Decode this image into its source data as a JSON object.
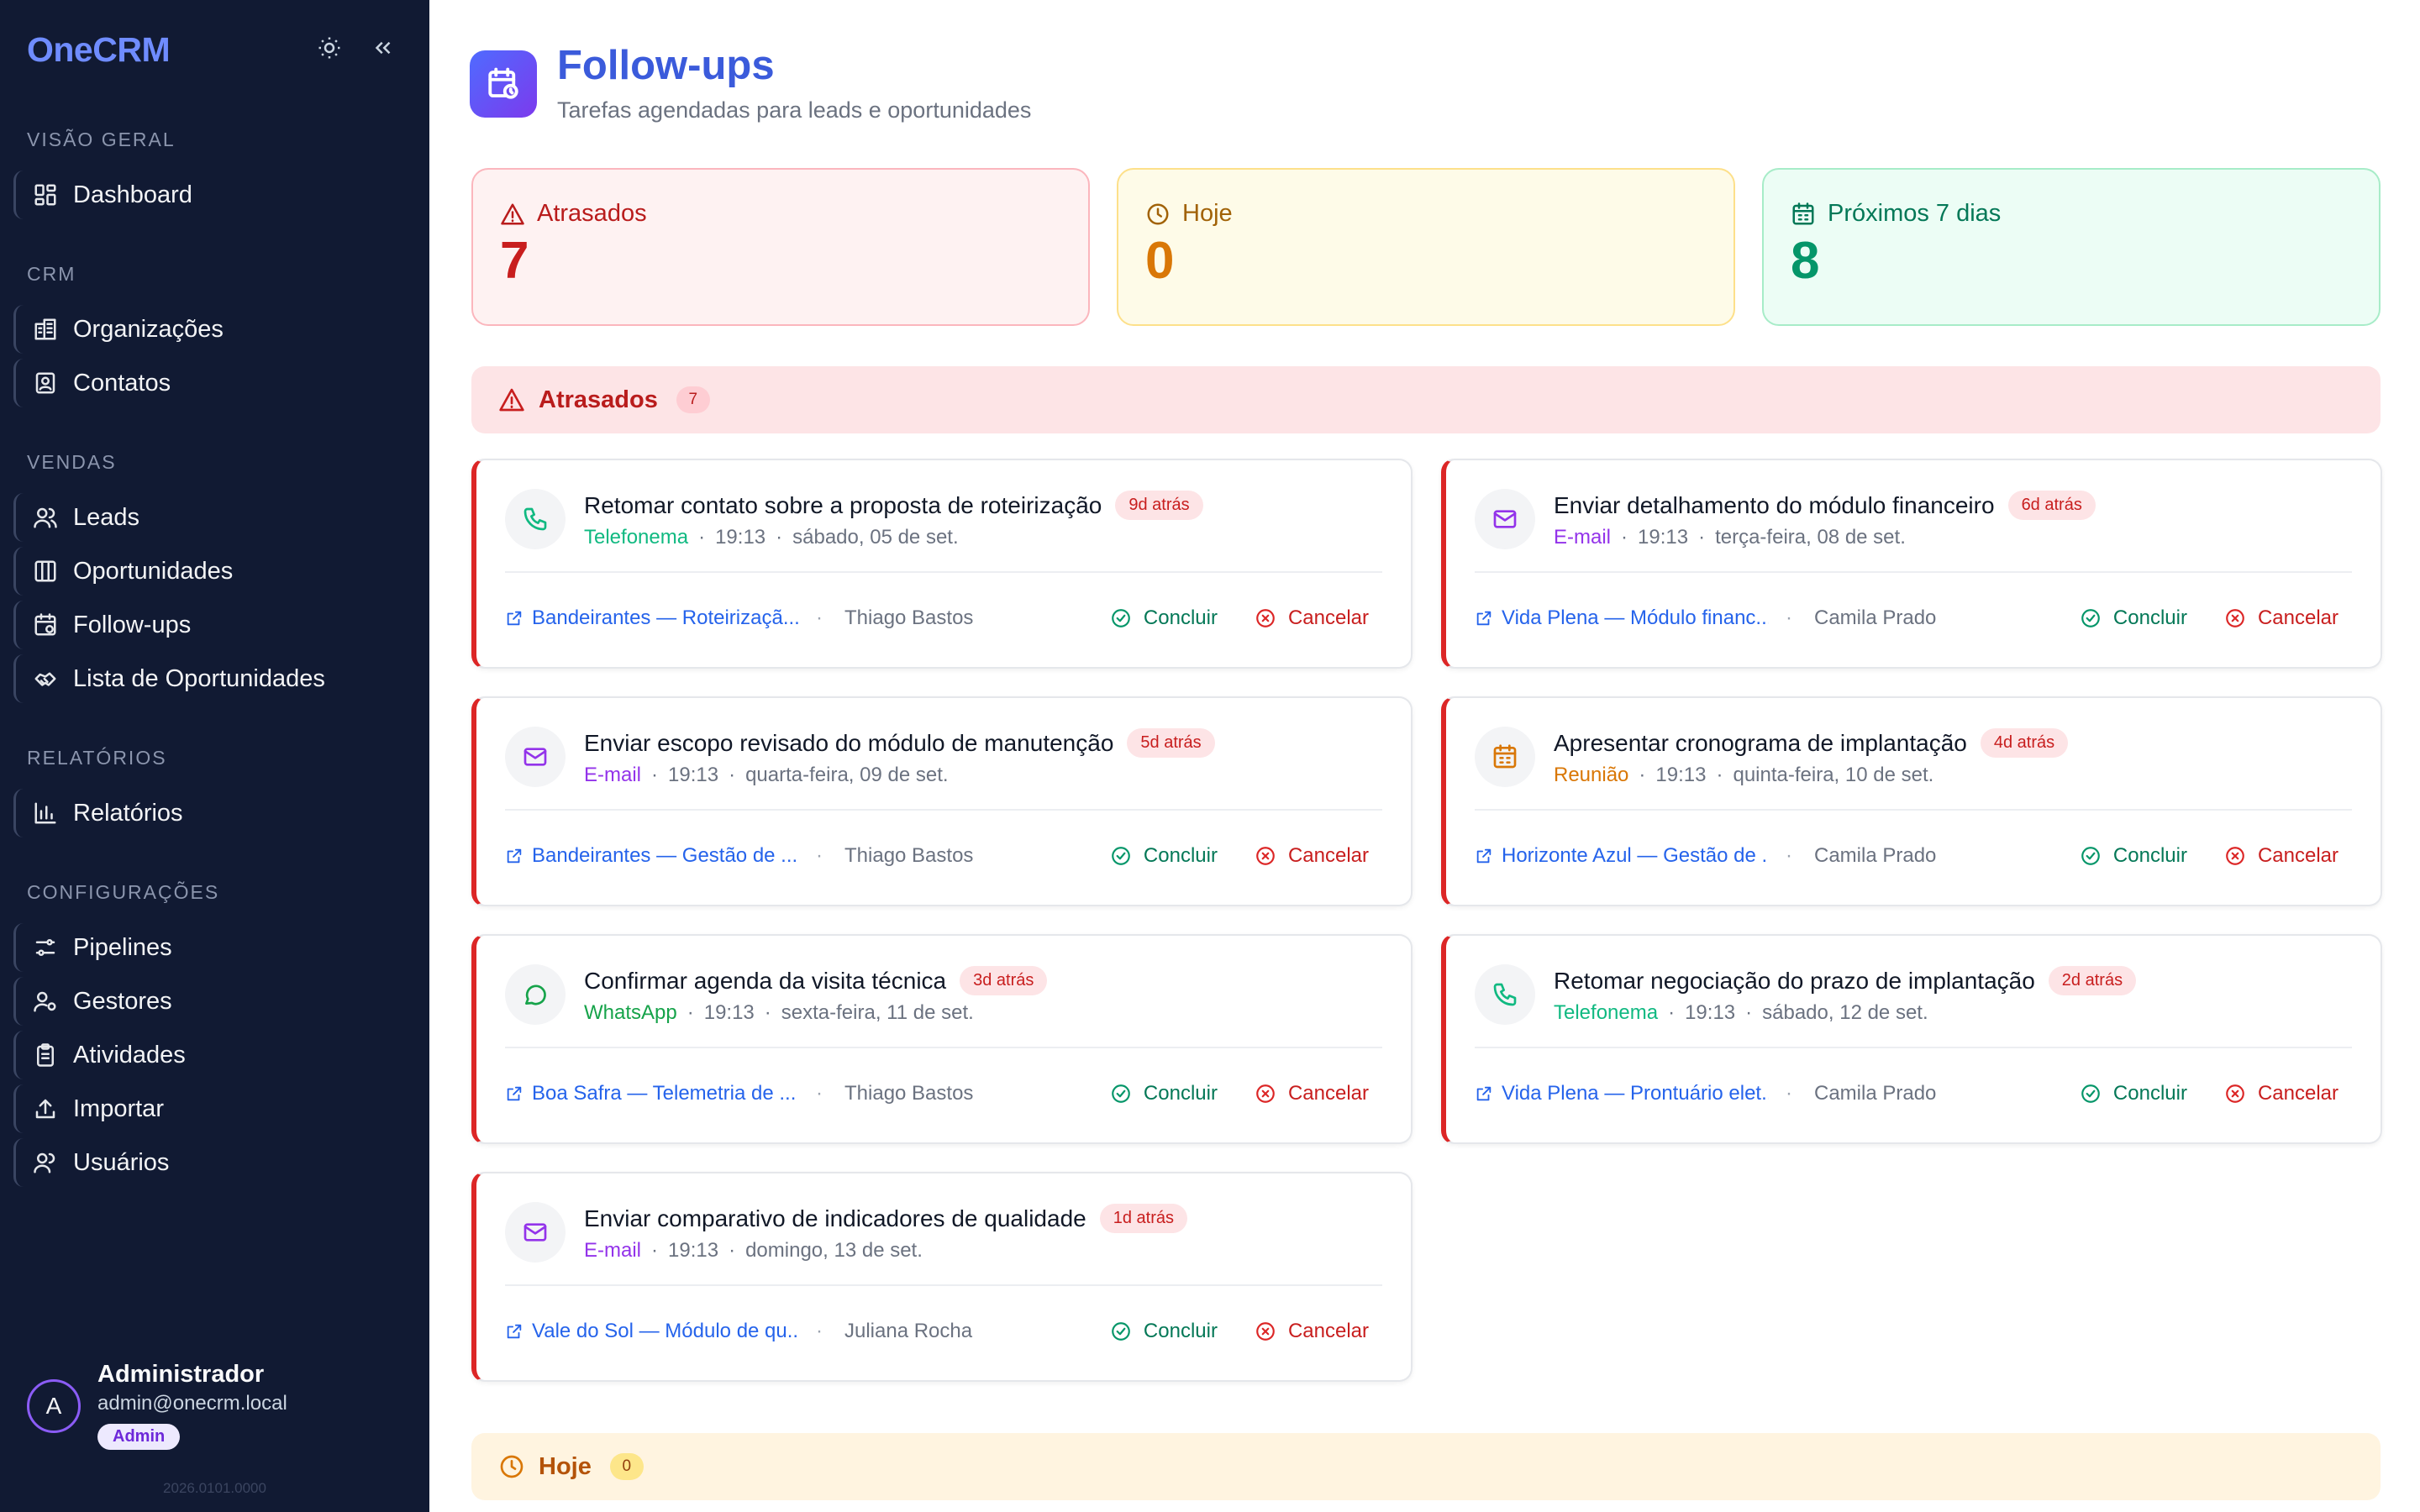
{
  "sidebar": {
    "brand": "OneCRM",
    "sections": {
      "overview": "VISÃO GERAL",
      "crm": "CRM",
      "sales": "VENDAS",
      "reports": "RELATÓRIOS",
      "settings": "CONFIGURAÇÕES"
    },
    "items": {
      "dashboard": "Dashboard",
      "organizations": "Organizações",
      "contacts": "Contatos",
      "leads": "Leads",
      "opportunities": "Oportunidades",
      "followups": "Follow-ups",
      "opportunity_list": "Lista de Oportunidades",
      "reports": "Relatórios",
      "pipelines": "Pipelines",
      "managers": "Gestores",
      "activities": "Atividades",
      "import": "Importar",
      "users": "Usuários"
    },
    "user": {
      "name": "Administrador",
      "email": "admin@onecrm.local",
      "role": "Admin",
      "initial": "A"
    },
    "version": "2026.0101.0000"
  },
  "header": {
    "title": "Follow-ups",
    "subtitle": "Tarefas agendadas para leads e oportunidades"
  },
  "stats": {
    "overdue": {
      "label": "Atrasados",
      "value": "7"
    },
    "today": {
      "label": "Hoje",
      "value": "0"
    },
    "next7": {
      "label": "Próximos 7 dias",
      "value": "8"
    }
  },
  "groups": {
    "overdue": {
      "label": "Atrasados",
      "count": "7"
    },
    "today": {
      "label": "Hoje",
      "count": "0"
    }
  },
  "actions": {
    "complete": "Concluir",
    "cancel": "Cancelar"
  },
  "cards": [
    {
      "title": "Retomar contato sobre a proposta de roteirização",
      "ago": "9d atrás",
      "type": "Telefonema",
      "time": "19:13",
      "date": "sábado, 05 de set.",
      "link": "Bandeirantes — Roteirizaçã...",
      "owner": "Thiago Bastos"
    },
    {
      "title": "Enviar detalhamento do módulo financeiro",
      "ago": "6d atrás",
      "type": "E-mail",
      "time": "19:13",
      "date": "terça-feira, 08 de set.",
      "link": "Vida Plena — Módulo financ...",
      "owner": "Camila Prado"
    },
    {
      "title": "Enviar escopo revisado do módulo de manutenção",
      "ago": "5d atrás",
      "type": "E-mail",
      "time": "19:13",
      "date": "quarta-feira, 09 de set.",
      "link": "Bandeirantes — Gestão de ...",
      "owner": "Thiago Bastos"
    },
    {
      "title": "Apresentar cronograma de implantação",
      "ago": "4d atrás",
      "type": "Reunião",
      "time": "19:13",
      "date": "quinta-feira, 10 de set.",
      "link": "Horizonte Azul — Gestão de ...",
      "owner": "Camila Prado"
    },
    {
      "title": "Confirmar agenda da visita técnica",
      "ago": "3d atrás",
      "type": "WhatsApp",
      "time": "19:13",
      "date": "sexta-feira, 11 de set.",
      "link": "Boa Safra — Telemetria de ...",
      "owner": "Thiago Bastos"
    },
    {
      "title": "Retomar negociação do prazo de implantação",
      "ago": "2d atrás",
      "type": "Telefonema",
      "time": "19:13",
      "date": "sábado, 12 de set.",
      "link": "Vida Plena — Prontuário elet...",
      "owner": "Camila Prado"
    },
    {
      "title": "Enviar comparativo de indicadores de qualidade",
      "ago": "1d atrás",
      "type": "E-mail",
      "time": "19:13",
      "date": "domingo, 13 de set.",
      "link": "Vale do Sol — Módulo de qu...",
      "owner": "Juliana Rocha"
    }
  ],
  "colors": {
    "sidebar_bg": "#111a33",
    "brand": "#6f8cff",
    "overdue": "#dc2626",
    "today": "#d97706",
    "upcoming": "#059669",
    "link": "#2563eb"
  },
  "icons": {
    "theme_toggle": "sun-icon",
    "collapse": "chevrons-left-icon",
    "page": "calendar-clock-icon",
    "overdue": "alert-triangle-icon",
    "today": "clock-icon",
    "next7": "calendar-icon",
    "link": "external-link-icon",
    "complete": "check-circle-icon",
    "cancel": "x-circle-icon"
  }
}
